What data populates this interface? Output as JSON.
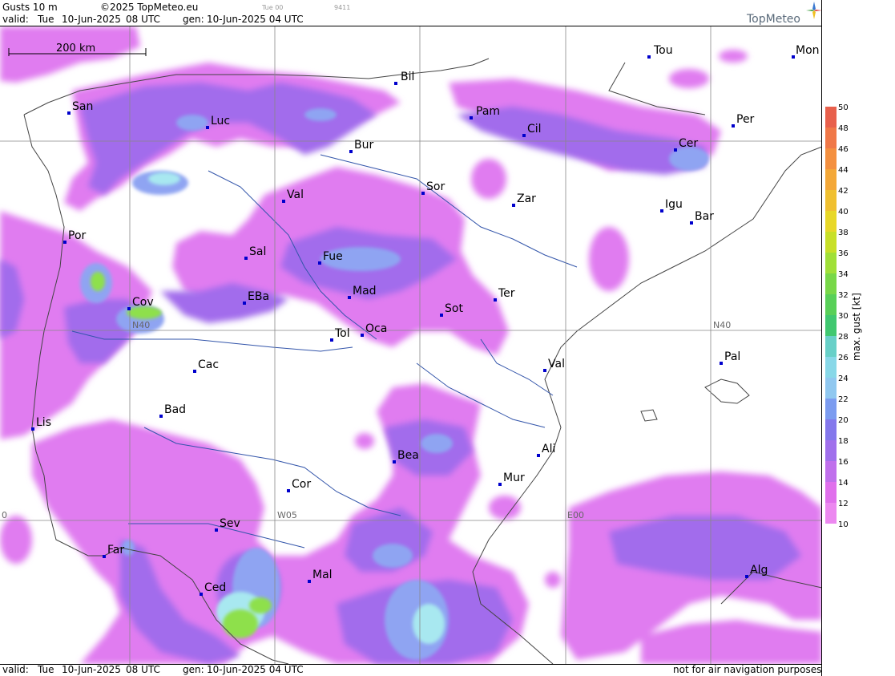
{
  "header": {
    "title": "Gusts 10 m",
    "copyright": "©2025 TopMeteo.eu",
    "small1": "Tue 00",
    "small2": "9411",
    "valid_label": "valid:",
    "valid_day": "Tue",
    "valid_date": "10-Jun-2025",
    "valid_time": "08 UTC",
    "gen_label": "gen:",
    "gen_value": "10-Jun-2025 04 UTC"
  },
  "logo": {
    "text": "TopMeteo"
  },
  "scale_bar": {
    "label": "200 km"
  },
  "grid_labels": {
    "n40_left": "N40",
    "n40_right": "N40",
    "w05": "W05",
    "e00": "E00",
    "w10": "0"
  },
  "cities": [
    {
      "id": "bil",
      "label": "Bil"
    },
    {
      "id": "tou",
      "label": "Tou"
    },
    {
      "id": "mon",
      "label": "Mon"
    },
    {
      "id": "san",
      "label": "San"
    },
    {
      "id": "pam",
      "label": "Pam"
    },
    {
      "id": "luc",
      "label": "Luc"
    },
    {
      "id": "cil",
      "label": "Cil"
    },
    {
      "id": "per",
      "label": "Per"
    },
    {
      "id": "bur",
      "label": "Bur"
    },
    {
      "id": "cer",
      "label": "Cer"
    },
    {
      "id": "sor",
      "label": "Sor"
    },
    {
      "id": "val1",
      "label": "Val"
    },
    {
      "id": "zar",
      "label": "Zar"
    },
    {
      "id": "igu",
      "label": "Igu"
    },
    {
      "id": "bar",
      "label": "Bar"
    },
    {
      "id": "por",
      "label": "Por"
    },
    {
      "id": "sal",
      "label": "Sal"
    },
    {
      "id": "fue",
      "label": "Fue"
    },
    {
      "id": "mad",
      "label": "Mad"
    },
    {
      "id": "ter",
      "label": "Ter"
    },
    {
      "id": "cov",
      "label": "Cov"
    },
    {
      "id": "eba",
      "label": "EBa"
    },
    {
      "id": "sot",
      "label": "Sot"
    },
    {
      "id": "tol",
      "label": "Tol"
    },
    {
      "id": "oca",
      "label": "Oca"
    },
    {
      "id": "pal",
      "label": "Pal"
    },
    {
      "id": "cac",
      "label": "Cac"
    },
    {
      "id": "val2",
      "label": "Val"
    },
    {
      "id": "bad",
      "label": "Bad"
    },
    {
      "id": "lis",
      "label": "Lis"
    },
    {
      "id": "ali",
      "label": "Ali"
    },
    {
      "id": "bea",
      "label": "Bea"
    },
    {
      "id": "mur",
      "label": "Mur"
    },
    {
      "id": "cor",
      "label": "Cor"
    },
    {
      "id": "sev",
      "label": "Sev"
    },
    {
      "id": "far",
      "label": "Far"
    },
    {
      "id": "alg",
      "label": "Alg"
    },
    {
      "id": "mal",
      "label": "Mal"
    },
    {
      "id": "ced",
      "label": "Ced"
    }
  ],
  "legend": {
    "title": "max. gust [kt]",
    "ticks": [
      "50",
      "48",
      "46",
      "44",
      "42",
      "40",
      "38",
      "36",
      "34",
      "32",
      "30",
      "28",
      "26",
      "24",
      "22",
      "20",
      "18",
      "16",
      "14",
      "12",
      "10"
    ],
    "colors": [
      "#e8604c",
      "#f07848",
      "#f49040",
      "#f4a838",
      "#f0c030",
      "#e8d828",
      "#c8e028",
      "#a0e038",
      "#78d848",
      "#58d058",
      "#40c870",
      "#68d0c8",
      "#88d8e8",
      "#90c8f0",
      "#7c9cf0",
      "#8478ec",
      "#a070ec",
      "#c070ec",
      "#e070ec",
      "#ec88f0"
    ]
  },
  "footer": {
    "valid_label": "valid:",
    "valid_day": "Tue",
    "valid_date": "10-Jun-2025",
    "valid_time": "08 UTC",
    "gen_label": "gen:",
    "gen_value": "10-Jun-2025 04 UTC",
    "disclaimer": "not for air navigation purposes"
  }
}
